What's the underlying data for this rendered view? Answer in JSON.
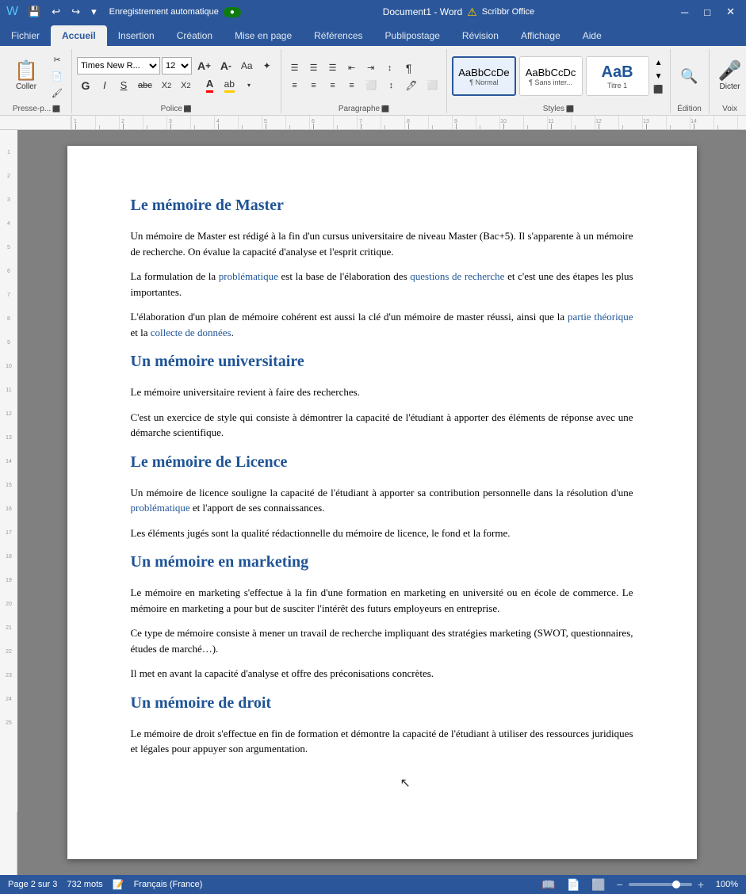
{
  "titlebar": {
    "autosave_label": "Enregistrement automatique",
    "autosave_on": true,
    "title": "Document1 - Word",
    "scribbr_label": "Scribbr Office",
    "warning_icon": "⚠",
    "minimize_icon": "─",
    "maximize_icon": "□",
    "close_icon": "✕"
  },
  "ribbon": {
    "tabs": [
      "Fichier",
      "Accueil",
      "Insertion",
      "Création",
      "Mise en page",
      "Références",
      "Publipostage",
      "Révision",
      "Affichage",
      "Aide"
    ],
    "active_tab": "Accueil",
    "groups": {
      "presse_papiers": {
        "label": "Presse-p...",
        "coller_label": "Coller"
      },
      "police": {
        "label": "Police",
        "font_name": "Times New R...",
        "font_size": "12",
        "bold": "G",
        "italic": "I",
        "underline": "S",
        "strikethrough": "abc",
        "subscript": "X₂",
        "superscript": "X²",
        "font_color_label": "A",
        "highlight_label": "ab"
      },
      "paragraphe": {
        "label": "Paragraphe"
      },
      "styles": {
        "label": "Styles",
        "items": [
          {
            "name": "Normal",
            "label": "Normal",
            "preview": "AaBbCcDe",
            "active": true
          },
          {
            "name": "SansInterligne",
            "label": "Sans inter...",
            "preview": "AaBbCcDc",
            "active": false
          },
          {
            "name": "Titre1",
            "label": "Titre 1",
            "preview": "AaB",
            "active": false
          }
        ]
      },
      "edition": {
        "label": "Édition",
        "search_icon": "🔍"
      },
      "voix": {
        "label": "Voix",
        "dicter_label": "Dicter",
        "mic_icon": "🎤"
      }
    }
  },
  "document": {
    "sections": [
      {
        "type": "heading",
        "text": "Le mémoire de Master"
      },
      {
        "type": "paragraph",
        "text": "Un mémoire de Master est rédigé à la fin d’un cursus universitaire de niveau Master (Bac+5). Il s’apparente à un mémoire de recherche. On évalue la capacité d’analyse et l’esprit critique."
      },
      {
        "type": "paragraph",
        "html": true,
        "text": "La formulation de la <a class=\"doc-link\">problématique</a> est la base de l’élaboration des <a class=\"doc-link\">questions de recherche</a> et c’est une des étapes les plus importantes."
      },
      {
        "type": "paragraph",
        "html": true,
        "text": "L’élaboration d’un plan de mémoire cohérent est aussi la clé d’un mémoire de master réussi, ainsi que la <a class=\"doc-link\">partie théorique</a> et la <a class=\"doc-link\">collecte de données</a>."
      },
      {
        "type": "heading",
        "text": "Un mémoire universitaire"
      },
      {
        "type": "paragraph",
        "text": "Le mémoire universitaire revient à faire des recherches."
      },
      {
        "type": "paragraph",
        "text": "C’est un exercice de style qui consiste à démontrer la capacité de l’étudiant à apporter des éléments de réponse avec une démarche scientifique."
      },
      {
        "type": "heading",
        "text": "Le mémoire de Licence"
      },
      {
        "type": "paragraph",
        "html": true,
        "text": "Un mémoire de licence souligne la capacité de l’étudiant à apporter sa contribution personnelle dans la résolution d’une <a class=\"doc-link\">problématique</a> et l’apport de ses connaissances."
      },
      {
        "type": "paragraph",
        "text": "Les éléments jugés sont la qualité rédactionnelle du mémoire de licence, le fond et la forme."
      },
      {
        "type": "heading",
        "text": "Un mémoire en marketing"
      },
      {
        "type": "paragraph",
        "text": "Le mémoire en marketing s’effectue à la fin d’une formation en marketing en université ou en école de commerce. Le mémoire en marketing a pour but de susciter l’intérêt des futurs employeurs en entreprise."
      },
      {
        "type": "paragraph",
        "text": "Ce type de mémoire consiste à mener un travail de recherche impliquant des stratégies marketing (SWOT, questionnaires, études de marché…)."
      },
      {
        "type": "paragraph",
        "text": "Il met en avant la capacité d’analyse et offre des préconisations concrètes."
      },
      {
        "type": "heading",
        "text": "Un mémoire de droit"
      },
      {
        "type": "paragraph",
        "text": "Le mémoire de droit s’effectue en fin de formation et démontre la capacité de l’étudiant à utiliser des ressources juridiques et légales pour appuyer son argumentation."
      }
    ]
  },
  "statusbar": {
    "page_info": "Page 2 sur 3",
    "word_count": "732 mots",
    "track_changes_icon": "📝",
    "language": "Français (France)",
    "read_icon": "📖",
    "layout_icon": "📄",
    "focus_icon": "⬜",
    "zoom_percent": "100%",
    "zoom_minus": "−",
    "zoom_plus": "+"
  }
}
